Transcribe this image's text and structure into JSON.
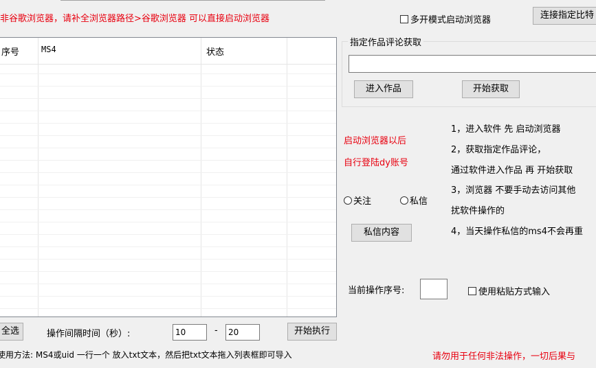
{
  "header": {
    "warning": "非谷歌浏览器，请补全浏览器路径>谷歌浏览器 可以直接启动浏览器",
    "multi_open_label": "多开模式启动浏览器",
    "connect_button": "连接指定比特"
  },
  "table": {
    "columns": [
      "序号",
      "MS4",
      "状态"
    ],
    "rows": []
  },
  "comment_group": {
    "title": "指定作品评论获取",
    "url_value": "",
    "enter_button": "进入作品",
    "start_fetch_button": "开始获取"
  },
  "side_notice": {
    "line1": "启动浏览器以后",
    "line2": "自行登陆dy账号"
  },
  "instructions": [
    "1，进入软件 先 启动浏览器",
    "2，获取指定作品评论，",
    "通过软件进入作品 再 开始获取",
    "3，浏览器 不要手动去访问其他",
    "扰软件操作的",
    "4，当天操作私信的ms4不会再重"
  ],
  "mode": {
    "follow_label": "关注",
    "message_label": "私信"
  },
  "message_content_button": "私信内容",
  "current_index": {
    "label": "当前操作序号:",
    "value": ""
  },
  "paste_input_label": "使用粘贴方式输入",
  "bottom": {
    "select_all_button": "全选",
    "interval_label": "操作间隔时间（秒）:",
    "interval_min": "10",
    "dash": "-",
    "interval_max": "20",
    "start_button": "开始执行",
    "usage": "使用方法: MS4或uid 一行一个 放入txt文本，然后把txt文本拖入列表框即可导入",
    "disclaimer": "请勿用于任何非法操作，一切后果与"
  },
  "colors": {
    "warning_red": "#e8000f",
    "window_bg": "#f0f0f0",
    "button_bg": "#e1e1e1"
  }
}
